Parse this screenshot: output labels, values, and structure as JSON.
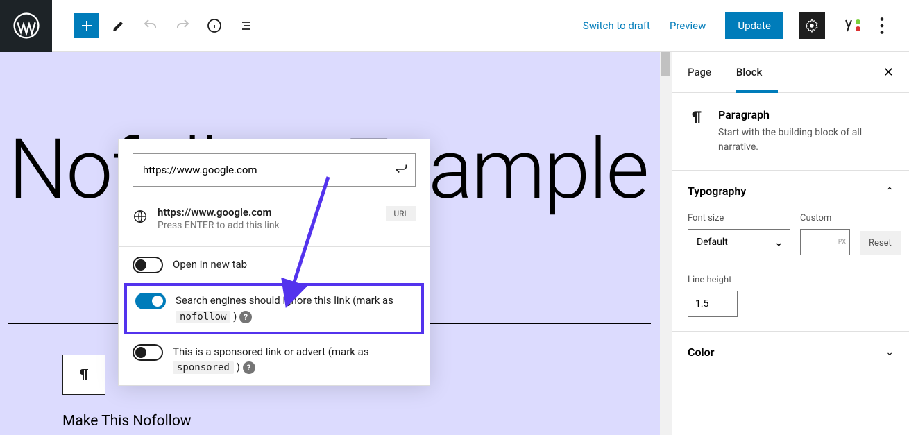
{
  "topbar": {
    "switch_to_draft": "Switch to draft",
    "preview": "Preview",
    "update": "Update"
  },
  "canvas": {
    "page_title": "Nofollow Example",
    "paragraph_text": "Make This Nofollow"
  },
  "link_popup": {
    "url_input": "https://www.google.com",
    "result_title": "https://www.google.com",
    "result_sub": "Press ENTER to add this link",
    "url_badge": "URL",
    "toggles": {
      "new_tab": {
        "label": "Open in new tab",
        "on": false
      },
      "nofollow": {
        "label_pre": "Search engines should ignore this link (mark as ",
        "code": "nofollow",
        "label_post": " )",
        "on": true
      },
      "sponsored": {
        "label_pre": "This is a sponsored link or advert (mark as ",
        "code": "sponsored",
        "label_post": " )",
        "on": false
      }
    }
  },
  "sidebar": {
    "tabs": {
      "page": "Page",
      "block": "Block"
    },
    "block_info": {
      "title": "Paragraph",
      "desc": "Start with the building block of all narrative."
    },
    "typography": {
      "title": "Typography",
      "font_size_label": "Font size",
      "font_size_value": "Default",
      "custom_label": "Custom",
      "custom_unit": "PX",
      "reset": "Reset",
      "line_height_label": "Line height",
      "line_height_value": "1.5"
    },
    "color": {
      "title": "Color"
    }
  }
}
